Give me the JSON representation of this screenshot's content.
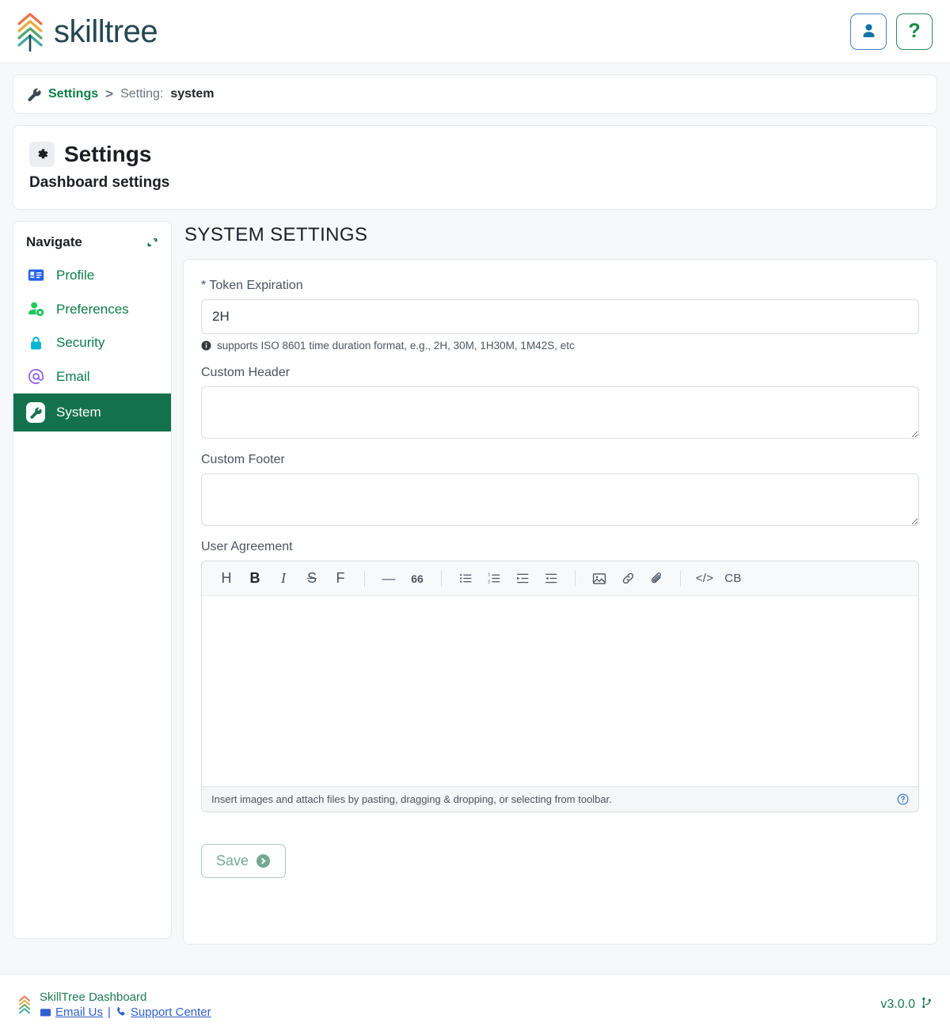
{
  "header": {
    "brand_name": "skilltree",
    "user_button_icon": "user-icon",
    "help_button_icon": "question-mark-icon",
    "help_button_label": "?"
  },
  "breadcrumb": {
    "icon": "wrench-icon",
    "root_label": "Settings",
    "separator": ">",
    "current_prefix": "Setting:",
    "current_value": "system"
  },
  "page": {
    "icon": "gear-icon",
    "title": "Settings",
    "subtitle": "Dashboard settings"
  },
  "sidebar": {
    "title": "Navigate",
    "collapse_icon": "compress-arrows-icon",
    "items": [
      {
        "label": "Profile",
        "icon": "id-card-icon",
        "color": "#2563eb",
        "active": false
      },
      {
        "label": "Preferences",
        "icon": "user-gear-icon",
        "color": "#22c55e",
        "active": false
      },
      {
        "label": "Security",
        "icon": "lock-icon",
        "color": "#06b6d4",
        "active": false
      },
      {
        "label": "Email",
        "icon": "at-sign-icon",
        "color": "#8b5cf6",
        "active": false
      },
      {
        "label": "System",
        "icon": "wrench-icon",
        "color": "#13724d",
        "active": true
      }
    ]
  },
  "main": {
    "section_title": "SYSTEM SETTINGS",
    "fields": {
      "token_expiration": {
        "label": "* Token Expiration",
        "value": "2H",
        "hint": "supports ISO 8601 time duration format, e.g., 2H, 30M, 1H30M, 1M42S, etc",
        "hint_icon": "info-circle-icon"
      },
      "custom_header": {
        "label": "Custom Header",
        "value": ""
      },
      "custom_footer": {
        "label": "Custom Footer",
        "value": ""
      },
      "user_agreement": {
        "label": "User Agreement",
        "value": ""
      }
    },
    "editor": {
      "toolbar": [
        {
          "name": "heading-button",
          "glyph": "H",
          "style": "letter"
        },
        {
          "name": "bold-button",
          "glyph": "B",
          "style": "letter b"
        },
        {
          "name": "italic-button",
          "glyph": "I",
          "style": "letter i"
        },
        {
          "name": "strikethrough-button",
          "glyph": "S",
          "style": "letter s"
        },
        {
          "name": "font-button",
          "glyph": "F",
          "style": "letter"
        },
        {
          "name": "horizontal-rule-button",
          "glyph": "—",
          "style": ""
        },
        {
          "name": "blockquote-button",
          "glyph": "66",
          "style": "quote"
        },
        {
          "name": "bullet-list-button",
          "glyph": "svg:bullet-list",
          "style": ""
        },
        {
          "name": "numbered-list-button",
          "glyph": "svg:numbered-list",
          "style": ""
        },
        {
          "name": "indent-button",
          "glyph": "svg:indent",
          "style": ""
        },
        {
          "name": "outdent-button",
          "glyph": "svg:outdent",
          "style": ""
        },
        {
          "name": "insert-image-button",
          "glyph": "svg:image",
          "style": ""
        },
        {
          "name": "insert-link-button",
          "glyph": "svg:link",
          "style": ""
        },
        {
          "name": "attach-file-button",
          "glyph": "svg:paperclip",
          "style": ""
        },
        {
          "name": "inline-code-button",
          "glyph": "</>",
          "style": "small"
        },
        {
          "name": "code-block-button",
          "glyph": "CB",
          "style": "small"
        }
      ],
      "footer_text": "Insert images and attach files by pasting, dragging & dropping, or selecting from toolbar.",
      "footer_help_icon": "question-circle-icon"
    },
    "save_button": {
      "label": "Save",
      "icon": "arrow-circle-right-icon",
      "disabled": true
    }
  },
  "footer": {
    "app_name": "SkillTree Dashboard",
    "email_link": "Email Us",
    "email_icon": "envelope-icon",
    "separator": "|",
    "support_link": "Support Center",
    "support_icon": "phone-icon",
    "version": "v3.0.0",
    "version_icon": "code-branch-icon"
  },
  "colors": {
    "brand_dark": "#264653",
    "primary_green": "#13724d",
    "link_green": "#0a7d48",
    "link_blue": "#2f5fd0",
    "page_bg": "#f7f8fa",
    "border": "#e6e8eb"
  }
}
